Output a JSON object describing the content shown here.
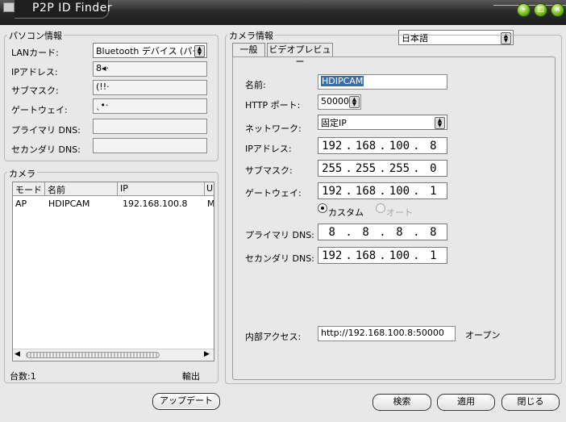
{
  "window": {
    "title": "P2P ID Finder"
  },
  "pc_info": {
    "group_label": "パソコン情報",
    "lan_card_label": "LANカード:",
    "lan_card_value": "Bluetooth デバイス (パー",
    "ip_label": "IPアドレス:",
    "ip_value": "8◂·",
    "subnet_label": "サブマスク:",
    "subnet_value": "(!!·",
    "gateway_label": "ゲートウェイ:",
    "gateway_value": "ˎ•·",
    "primary_dns_label": "プライマリ DNS:",
    "primary_dns_value": "",
    "secondary_dns_label": "セカンダリ DNS:",
    "secondary_dns_value": ""
  },
  "camera_list": {
    "group_label": "カメラ",
    "columns": [
      "モード",
      "名前",
      "IP",
      "UI"
    ],
    "rows": [
      {
        "mode": "AP",
        "name": "HDIPCAM",
        "ip": "192.168.100.8",
        "ui": "M"
      }
    ],
    "count_label": "台数:1",
    "export_label": "輸出"
  },
  "update_button": "アップデート",
  "language": {
    "selected": "日本語"
  },
  "camera_info": {
    "group_label": "カメラ情報",
    "tabs": [
      "一般",
      "ビデオプレビュー"
    ],
    "name_label": "名前:",
    "name_value": "HDIPCAM",
    "http_port_label": "HTTP ポート:",
    "http_port_value": "50000",
    "network_label": "ネットワーク:",
    "network_value": "固定IP",
    "ip_label": "IPアドレス:",
    "ip": [
      "192",
      "168",
      "100",
      "8"
    ],
    "subnet_label": "サブマスク:",
    "subnet": [
      "255",
      "255",
      "255",
      "0"
    ],
    "gateway_label": "ゲートウェイ:",
    "gateway": [
      "192",
      "168",
      "100",
      "1"
    ],
    "dns_mode_custom": "カスタム",
    "dns_mode_auto": "オート",
    "primary_dns_label": "プライマリ DNS:",
    "primary_dns": [
      "8",
      "8",
      "8",
      "8"
    ],
    "secondary_dns_label": "セカンダリ DNS:",
    "secondary_dns": [
      "192",
      "168",
      "100",
      "1"
    ],
    "internal_access_label": "内部アクセス:",
    "internal_access_value": "http://192.168.100.8:50000",
    "open_label": "オープン"
  },
  "buttons": {
    "search": "検索",
    "apply": "適用",
    "close": "閉じる"
  }
}
